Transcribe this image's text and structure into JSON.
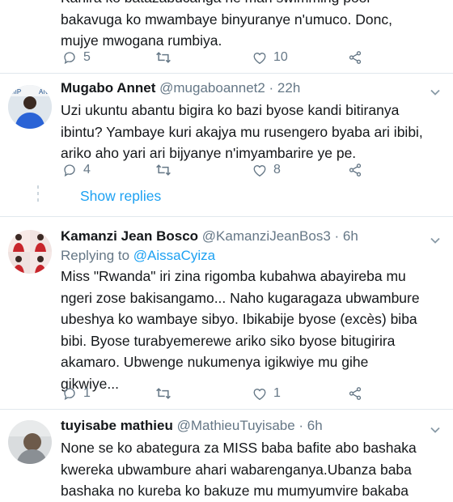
{
  "tweet0": {
    "text_lines": [
      "Kanira ko batazabucanga ne mari swimming pool",
      "bakavuga ko mwambaye binyuranye n'umuco. Donc,",
      "mujye mwogana rumbiya."
    ],
    "reply_count": "5",
    "retweet_count": "",
    "like_count": "10"
  },
  "tweet1": {
    "name": "Mugabo Annet",
    "handle": "@mugaboannet2 · 22h",
    "text_lines": [
      "Uzi ukuntu abantu bigira ko bazi byose kandi bitiranya",
      "ibintu? Yambaye kuri akajya mu rusengero byaba ari ibibi,",
      "ariko aho yari ari bijyanye n'imyambarire ye pe."
    ],
    "reply_count": "4",
    "retweet_count": "",
    "like_count": "8",
    "show_replies": "Show replies"
  },
  "tweet2": {
    "name": "Kamanzi Jean Bosco",
    "handle": "@KamanziJeanBos3 · 6h",
    "replying_prefix": "Replying to",
    "replying_to": "@AissaCyiza",
    "text_lines": [
      "Miss \"Rwanda\" iri zina rigomba kubahwa abayireba mu",
      "ngeri zose bakisangamo... Naho kugaragaza ubwambure",
      "ubeshya ko wambaye sibyo. Ibikabije byose (excès) biba",
      "bibi. Byose turabyemerewe ariko siko byose bitugirira",
      "akamaro. Ubwenge nukumenya igikwiye mu gihe",
      "gikwiye..."
    ],
    "reply_count": "1",
    "retweet_count": "",
    "like_count": "1"
  },
  "tweet3": {
    "name": "tuyisabe mathieu",
    "handle": "@MathieuTuyisabe · 6h",
    "text_lines": [
      "None se ko abategura za MISS baba bafite abo bashaka",
      "kwereka ubwambure ahari wabarenganya.Ubanza baba",
      "bashaka no kureba ko bakuze mu mumyumvire bakaba"
    ]
  },
  "colors": {
    "accent": "#1da1f2",
    "muted": "#657786",
    "text": "#14171a",
    "divider": "#e1e8ed"
  },
  "icons": [
    "reply-icon",
    "retweet-icon",
    "like-icon",
    "share-icon",
    "chevron-down-icon"
  ]
}
